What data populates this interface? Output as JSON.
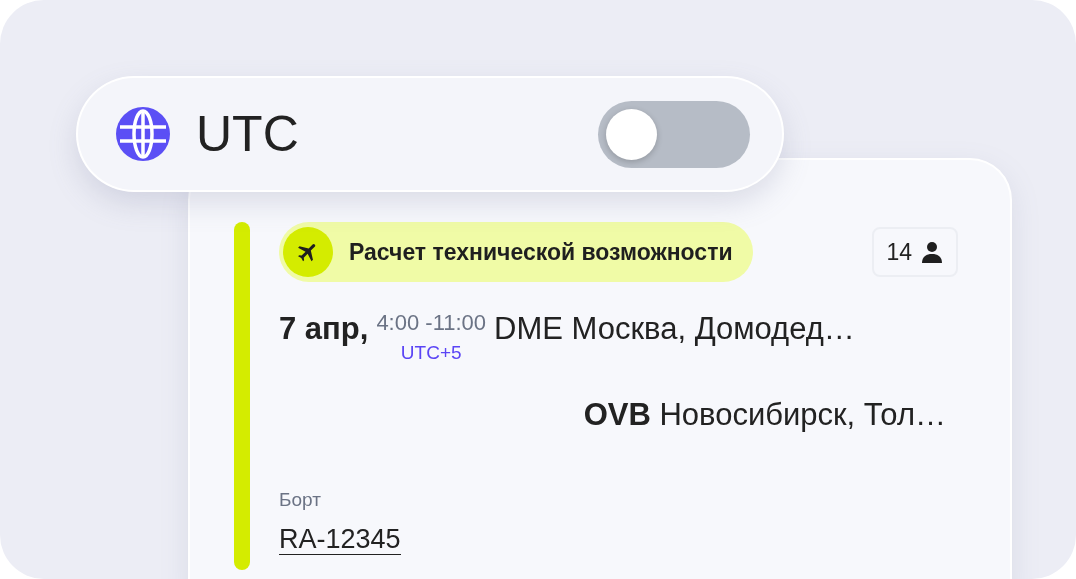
{
  "utc_toggle": {
    "label": "UTC",
    "on": false
  },
  "flight": {
    "status": "Расчет технической возможности",
    "passengers": "14",
    "date": "7 апр,",
    "time": "4:00 -11:00",
    "timezone": "UTC+5",
    "departure": {
      "code": "DME",
      "city": "Москва, Домодед…",
      "emphasized": false
    },
    "arrival": {
      "code": "OVB",
      "city": "Новосибирск, Тол…",
      "emphasized": true
    },
    "aircraft_label": "Борт",
    "aircraft": "RA-12345"
  }
}
